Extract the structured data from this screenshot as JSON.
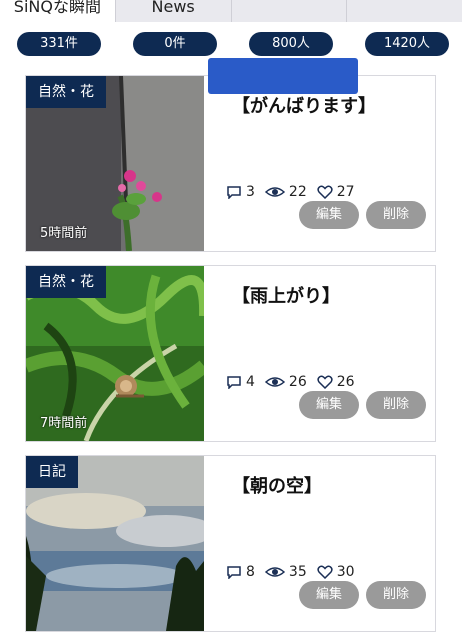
{
  "tabs": [
    {
      "label": "SiNQな瞬間",
      "active": true
    },
    {
      "label": "News",
      "active": false
    },
    {
      "label": "",
      "active": false
    },
    {
      "label": "",
      "active": false
    }
  ],
  "counts": [
    "331件",
    "0件",
    "800人",
    "1420人"
  ],
  "posts": [
    {
      "category": "自然・花",
      "title": "【がんばります】",
      "time_ago": "5時間前",
      "comments": "3",
      "views": "22",
      "likes": "27",
      "edit_label": "編集",
      "delete_label": "削除"
    },
    {
      "category": "自然・花",
      "title": "【雨上がり】",
      "time_ago": "7時間前",
      "comments": "4",
      "views": "26",
      "likes": "26",
      "edit_label": "編集",
      "delete_label": "削除"
    },
    {
      "category": "日記",
      "title": "【朝の空】",
      "time_ago": "",
      "comments": "8",
      "views": "35",
      "likes": "30",
      "edit_label": "編集",
      "delete_label": "削除"
    }
  ],
  "colors": {
    "navy": "#0e2a52",
    "button_gray": "#9a9a9a",
    "redaction_blue": "#2a5bc8"
  }
}
